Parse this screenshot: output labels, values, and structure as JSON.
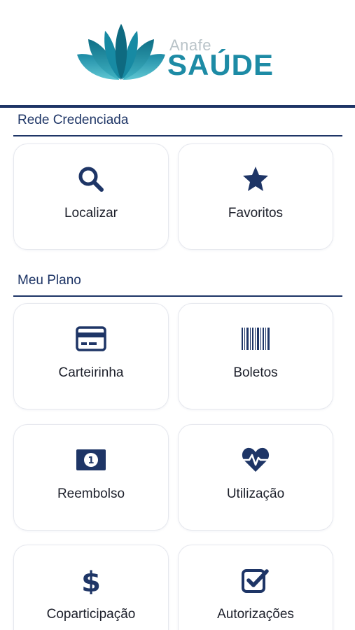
{
  "brand": {
    "small": "Anafe",
    "big": "SAÚDE"
  },
  "sections": [
    {
      "title": "Rede Credenciada"
    },
    {
      "title": "Meu Plano"
    }
  ],
  "cards": {
    "localizar": "Localizar",
    "favoritos": "Favoritos",
    "carteirinha": "Carteirinha",
    "boletos": "Boletos",
    "reembolso": "Reembolso",
    "utilizacao": "Utilização",
    "coparticipacao": "Coparticipação",
    "autorizacoes": "Autorizações"
  },
  "colors": {
    "primary": "#1e3566",
    "brand_teal": "#1d8ba5"
  }
}
